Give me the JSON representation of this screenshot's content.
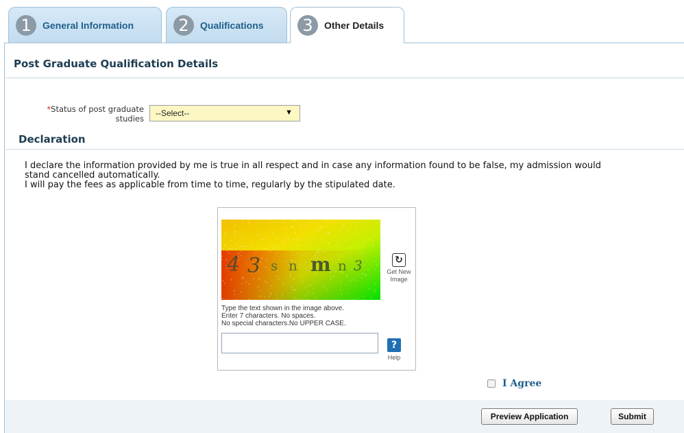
{
  "tabs": [
    {
      "number": "1",
      "label": "General Information"
    },
    {
      "number": "2",
      "label": "Qualifications"
    },
    {
      "number": "3",
      "label": "Other Details"
    }
  ],
  "active_tab": "Other Details",
  "post_grad": {
    "title": "Post Graduate Qualification Details",
    "required_mark": "*",
    "status_label_line1": "Status of post graduate",
    "status_label_line2": "studies",
    "status_select_value": "--Select--"
  },
  "declaration": {
    "title": "Declaration",
    "line1": "I declare the information provided by me is true in all respect and in case any information found to be false, my admission would",
    "line2": "stand cancelled automatically.",
    "line3": "I will pay the fees as applicable from time to time, regularly by the stipulated date."
  },
  "captcha": {
    "image_text": [
      "4",
      "3",
      "s",
      "n",
      "m",
      "n",
      "3"
    ],
    "get_new_line1": "Get New",
    "get_new_line2": "Image",
    "instruction1": "Type the text shown in the image above.",
    "instruction2": "Enter 7 characters. No spaces.",
    "instruction3": "No special characters.No UPPER CASE.",
    "input_value": "",
    "help_label": "Help",
    "help_icon_glyph": "?"
  },
  "agree": {
    "label": "I Agree",
    "checked": false
  },
  "buttons": {
    "preview": "Preview Application",
    "submit": "Submit"
  },
  "colors": {
    "tab_bg": "#c3dcef",
    "heading": "#1e3d52",
    "accent_blue": "#1f5f8b",
    "select_bg": "#fdf7c4",
    "footer_bg": "#eef3f8"
  }
}
